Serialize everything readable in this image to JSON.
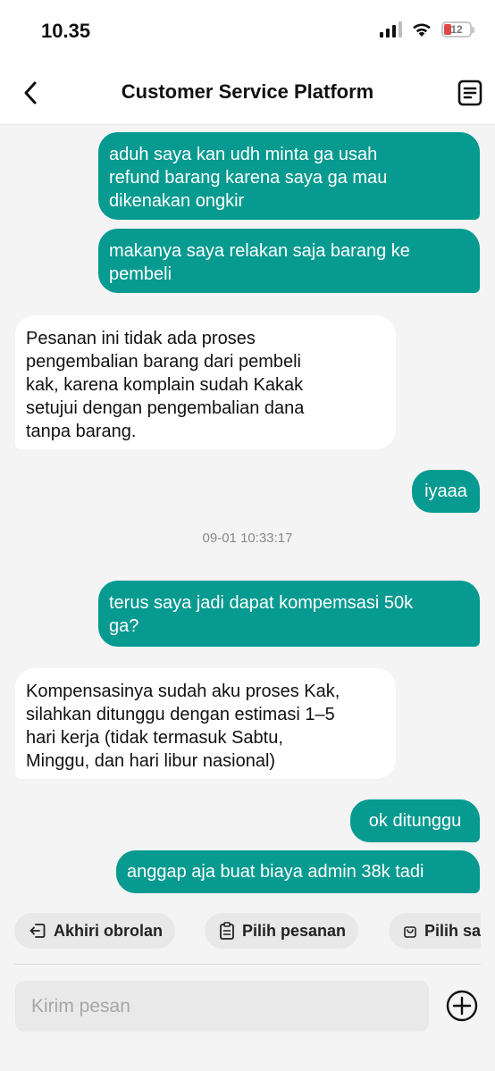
{
  "status_bar": {
    "time": "10.35",
    "battery_level": "12"
  },
  "header": {
    "title": "Customer Service Platform",
    "back_icon": "chevron-left-icon",
    "doc_icon": "document-icon"
  },
  "messages": [
    {
      "direction": "outgoing",
      "lines": [
        "aduh saya kan udh minta ga usah",
        "refund barang karena saya ga mau",
        "dikenakan ongkir"
      ]
    },
    {
      "direction": "outgoing",
      "lines": [
        "makanya saya relakan saja barang ke",
        "pembeli"
      ]
    },
    {
      "direction": "incoming",
      "lines": [
        "Pesanan ini tidak ada proses",
        "pengembalian barang dari pembeli",
        "kak, karena komplain sudah Kakak",
        "setujui dengan pengembalian dana",
        "tanpa barang."
      ]
    },
    {
      "direction": "outgoing",
      "lines": [
        "iyaaa"
      ]
    },
    {
      "direction": "outgoing",
      "lines": [
        "terus saya jadi dapat kompemsasi 50k",
        "ga?"
      ]
    },
    {
      "direction": "incoming",
      "lines": [
        "Kompensasinya sudah aku proses Kak,",
        "silahkan ditunggu dengan estimasi 1–5",
        "hari kerja (tidak termasuk Sabtu,",
        "Minggu, dan hari libur nasional)"
      ]
    },
    {
      "direction": "outgoing",
      "lines": [
        "ok ditunggu"
      ]
    },
    {
      "direction": "outgoing",
      "lines": [
        "anggap aja buat biaya admin 38k tadi"
      ]
    }
  ],
  "timestamp": "09-01 10:33:17",
  "quick_actions": [
    {
      "label": "Akhiri obrolan",
      "icon": "exit-icon"
    },
    {
      "label": "Pilih pesanan",
      "icon": "clipboard-icon"
    },
    {
      "label": "Pilih sa",
      "icon": "bag-icon"
    }
  ],
  "composer": {
    "placeholder": "Kirim pesan",
    "value": "",
    "plus_icon": "plus-circle-icon"
  },
  "colors": {
    "outgoing_bubble": "#079a90",
    "incoming_bubble": "#ffffff",
    "background": "#f4f4f4"
  }
}
